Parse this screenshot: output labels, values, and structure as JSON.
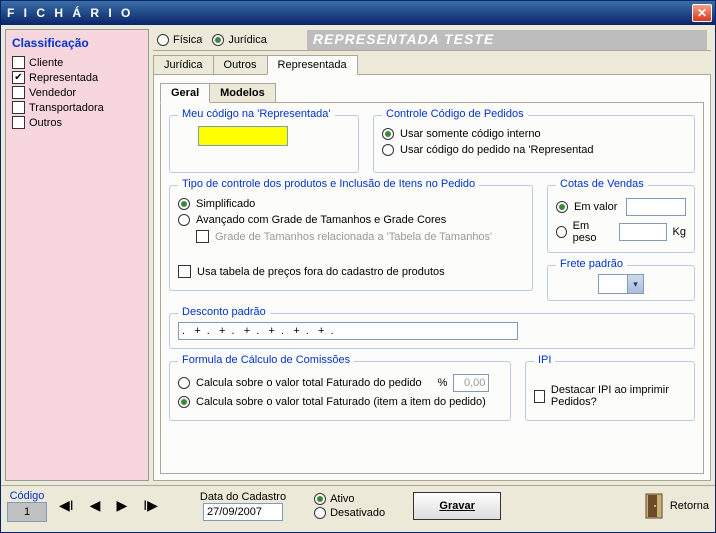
{
  "window": {
    "title": "F I C H Á R I O"
  },
  "sidebar": {
    "title": "Classificação",
    "items": [
      {
        "label": "Cliente",
        "checked": false
      },
      {
        "label": "Representada",
        "checked": true
      },
      {
        "label": "Vendedor",
        "checked": false
      },
      {
        "label": "Transportadora",
        "checked": false
      },
      {
        "label": "Outros",
        "checked": false
      }
    ]
  },
  "tipo_pessoa": {
    "fisica": "Física",
    "juridica": "Jurídica",
    "selected": "juridica"
  },
  "banner": "REPRESENTADA TESTE",
  "main_tabs": {
    "juridica": "Jurídica",
    "outros": "Outros",
    "representada": "Representada",
    "active": "representada"
  },
  "sub_tabs": {
    "geral": "Geral",
    "modelos": "Modelos",
    "active": "geral"
  },
  "geral": {
    "meu_codigo": {
      "title": "Meu código na 'Representada'",
      "value": ""
    },
    "controle_codigo": {
      "title": "Controle Código de Pedidos",
      "opt_interno": "Usar somente código interno",
      "opt_pedido": "Usar código do pedido na 'Representad",
      "selected": "interno"
    },
    "tipo_controle": {
      "title": "Tipo de controle dos produtos e Inclusão de Itens no Pedido",
      "simplificado": "Simplificado",
      "avancado": "Avançado com Grade de Tamanhos e Grade Cores",
      "grade_rel": "Grade de Tamanhos relacionada a 'Tabela de Tamanhos'",
      "usa_tabela": "Usa tabela de preços fora do cadastro de produtos",
      "selected": "simplificado"
    },
    "cotas": {
      "title": "Cotas de Vendas",
      "em_valor": "Em valor",
      "em_peso": "Em peso",
      "kg": "Kg",
      "valor_val": "",
      "peso_val": "",
      "selected": "valor"
    },
    "frete": {
      "title": "Frete padrão"
    },
    "desconto": {
      "title": "Desconto padrão",
      "value": ".   +  .   +  .   +  .   +  .   +  .   +  ."
    },
    "comissoes": {
      "title": "Formula de Cálculo de Comissões",
      "sobre_total": "Calcula sobre o valor total Faturado do pedido",
      "pct_sym": "%",
      "pct_val": "0,00",
      "item_a_item": "Calcula sobre o valor total Faturado (item a item do pedido)",
      "selected": "item"
    },
    "ipi": {
      "title": "IPI",
      "destacar": "Destacar IPI ao imprimir Pedidos?"
    }
  },
  "footer": {
    "codigo_label": "Código",
    "codigo_value": "1",
    "data_label": "Data do Cadastro",
    "data_value": "27/09/2007",
    "ativo": "Ativo",
    "desativado": "Desativado",
    "status_selected": "ativo",
    "gravar": "Gravar",
    "retorna": "Retorna"
  }
}
